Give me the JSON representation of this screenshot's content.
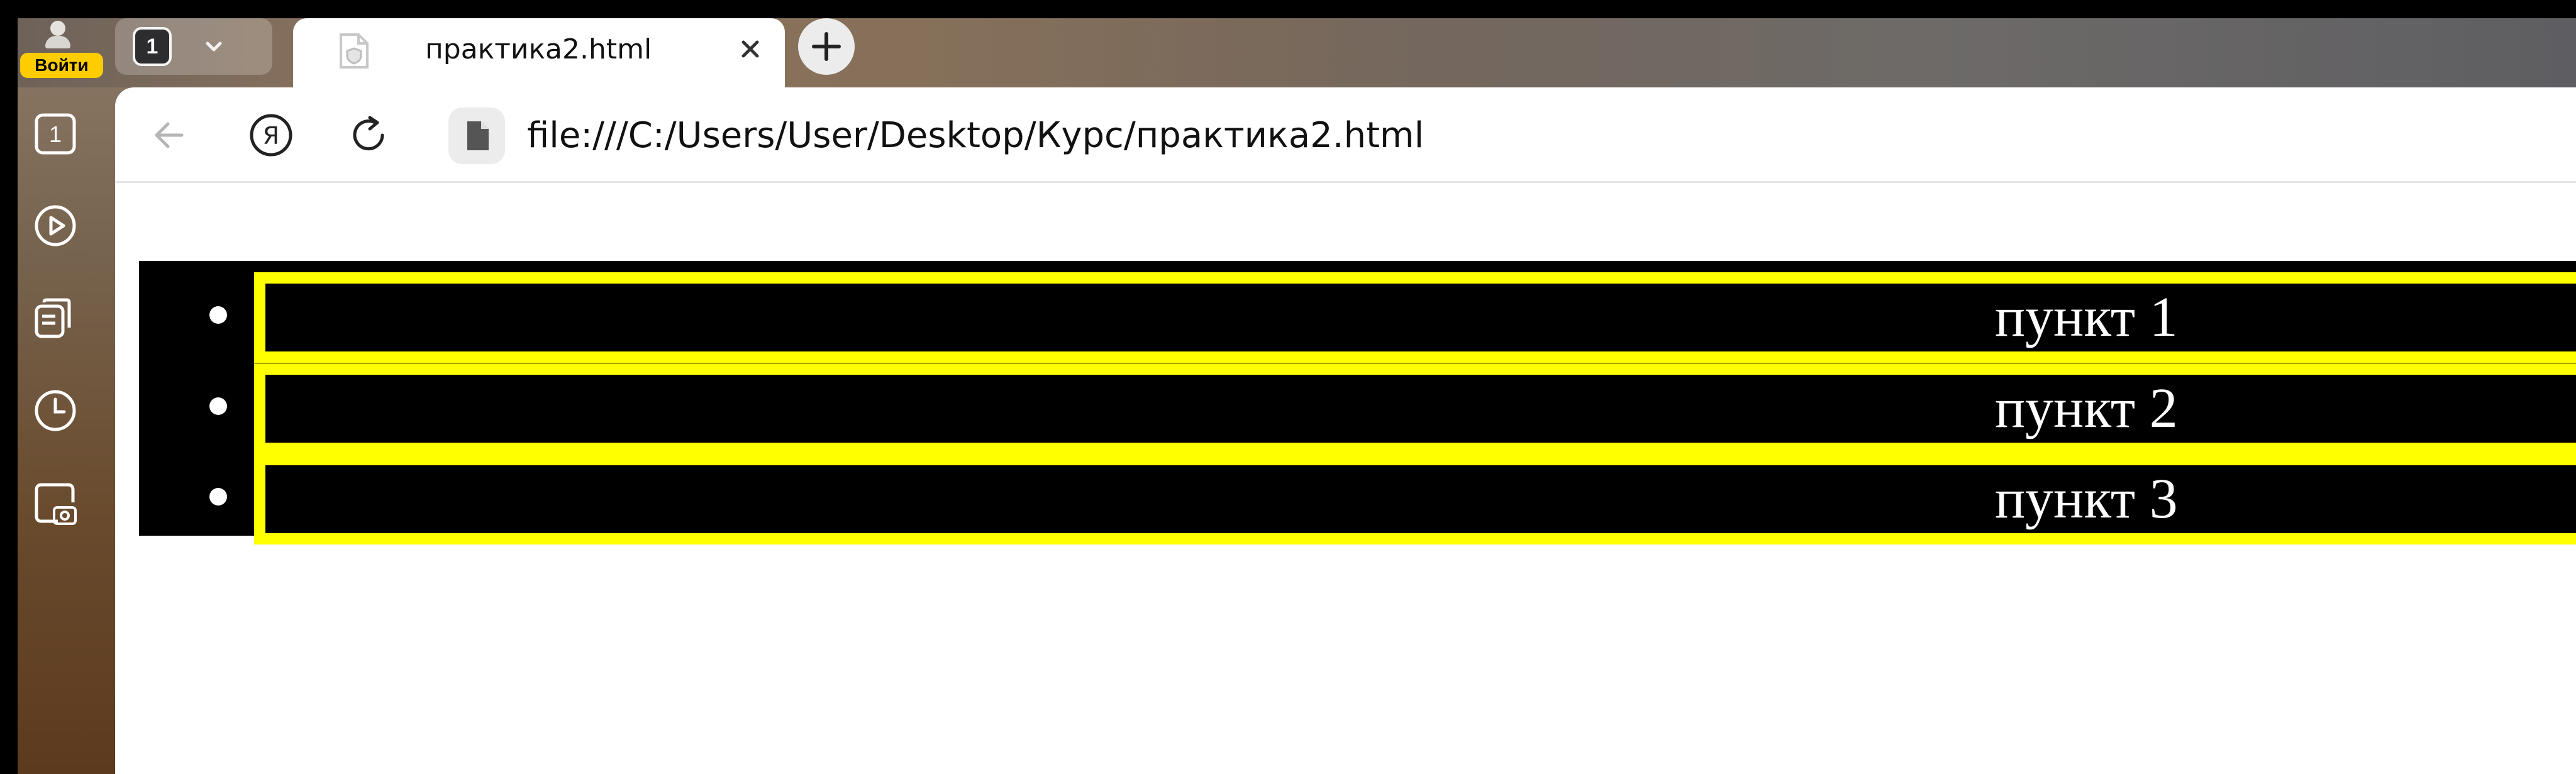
{
  "sidebar": {
    "login_label": "Войти",
    "items": [
      {
        "icon": "tabs-counter-icon",
        "label": "1"
      },
      {
        "icon": "play-icon"
      },
      {
        "icon": "collections-icon"
      },
      {
        "icon": "history-clock-icon"
      },
      {
        "icon": "screenshot-camera-icon"
      }
    ]
  },
  "tabstrip": {
    "tab_count": "1",
    "active_tab": {
      "title": "практика2.html",
      "favicon": "file-shield-icon"
    },
    "new_tab_icon": "plus-icon"
  },
  "toolbar": {
    "back_icon": "arrow-left-icon",
    "yandex_icon": "yandex-logo-icon",
    "reload_icon": "reload-icon",
    "page_icon": "file-icon",
    "address": "file:///C:/Users/User/Desktop/Курс/практика2.html"
  },
  "page": {
    "list_items": [
      {
        "text": "пункт 1"
      },
      {
        "text": "пункт 2"
      },
      {
        "text": "пункт 3"
      }
    ]
  },
  "colors": {
    "login_button": "#ffcc00",
    "list_background": "#000000",
    "item_border": "#ffff00",
    "item_text": "#ffffff"
  }
}
